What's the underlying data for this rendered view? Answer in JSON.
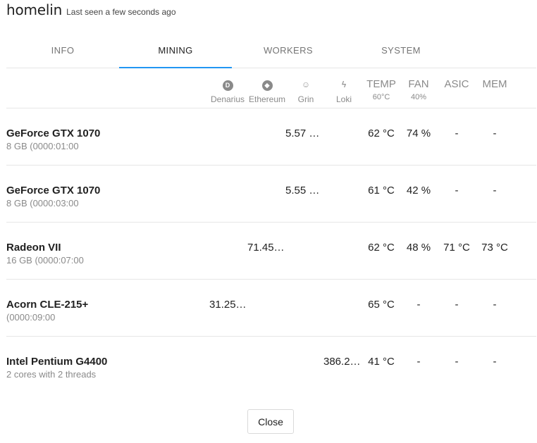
{
  "header": {
    "title": "homelin",
    "subtitle": "Last seen a few seconds ago"
  },
  "tabs": [
    {
      "label": "INFO",
      "active": false
    },
    {
      "label": "MINING",
      "active": true
    },
    {
      "label": "WORKERS",
      "active": false
    },
    {
      "label": "SYSTEM",
      "active": false
    }
  ],
  "columns": {
    "coins": [
      {
        "name": "Denarius",
        "icon": "denarius-coin-icon",
        "glyph": "D"
      },
      {
        "name": "Ethereum",
        "icon": "ethereum-coin-icon",
        "glyph": "◆"
      },
      {
        "name": "Grin",
        "icon": "grin-coin-icon",
        "glyph": "☺"
      },
      {
        "name": "Loki",
        "icon": "loki-coin-icon",
        "glyph": "ϟ"
      }
    ],
    "stats": [
      {
        "name": "TEMP",
        "sub": "60°C"
      },
      {
        "name": "FAN",
        "sub": "40%"
      },
      {
        "name": "ASIC",
        "sub": ""
      },
      {
        "name": "MEM",
        "sub": ""
      }
    ]
  },
  "devices": [
    {
      "name": "GeForce GTX 1070",
      "desc": "8 GB (0000:01:00",
      "hashrate": "5.57 …",
      "temp": "62 °C",
      "fan": "74 %",
      "asic": "-",
      "mem": "-"
    },
    {
      "name": "GeForce GTX 1070",
      "desc": "8 GB (0000:03:00",
      "hashrate": "5.55 …",
      "temp": "61 °C",
      "fan": "42 %",
      "asic": "-",
      "mem": "-"
    },
    {
      "name": "Radeon VII",
      "desc": "16 GB (0000:07:00",
      "hashrate": "71.45…",
      "temp": "62 °C",
      "fan": "48 %",
      "asic": "71 °C",
      "mem": "73 °C"
    },
    {
      "name": "Acorn CLE-215+",
      "desc": "(0000:09:00",
      "hashrate": "31.25…",
      "temp": "65 °C",
      "fan": "-",
      "asic": "-",
      "mem": "-"
    },
    {
      "name": "Intel Pentium G4400",
      "desc": "2 cores with 2 threads",
      "hashrate": "386.2…",
      "temp": "41 °C",
      "fan": "-",
      "asic": "-",
      "mem": "-"
    }
  ],
  "footer": {
    "close_label": "Close"
  },
  "colors": {
    "accent": "#2196f3",
    "divider": "#e6e6e6",
    "muted": "#8a8a8a"
  }
}
